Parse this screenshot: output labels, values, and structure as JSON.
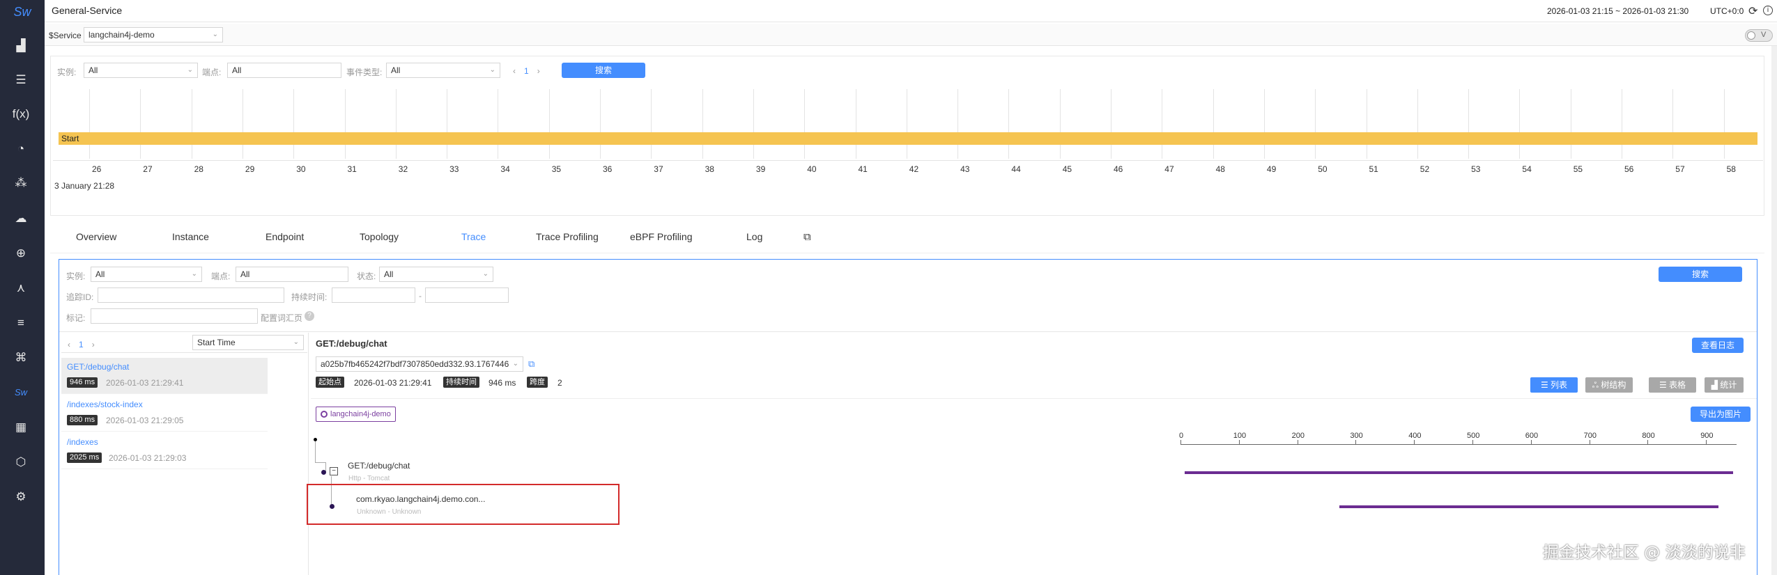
{
  "nav": {
    "logo": "Sw",
    "items": [
      {
        "name": "dashboard-icon",
        "glyph": "▟"
      },
      {
        "name": "database-icon",
        "glyph": "☰"
      },
      {
        "name": "function-icon",
        "glyph": "f(x)"
      },
      {
        "name": "pie-chart-icon",
        "glyph": "◔"
      },
      {
        "name": "dots-icon",
        "glyph": "⁂"
      },
      {
        "name": "cloud-icon",
        "glyph": "☁"
      },
      {
        "name": "globe-icon",
        "glyph": "⊕"
      },
      {
        "name": "network-icon",
        "glyph": "⋏"
      },
      {
        "name": "list-icon",
        "glyph": "≡"
      },
      {
        "name": "topology-icon",
        "glyph": "⌘"
      },
      {
        "name": "sw-icon",
        "glyph": "Sw"
      },
      {
        "name": "widgets-icon",
        "glyph": "▦"
      },
      {
        "name": "shield-icon",
        "glyph": "⬡"
      },
      {
        "name": "settings-icon",
        "glyph": "⚙"
      }
    ]
  },
  "header": {
    "title": "General-Service",
    "time_range": "2026-01-03 21:15 ~ 2026-01-03 21:30",
    "utc": "UTC+0:0"
  },
  "service_bar": {
    "label": "$Service",
    "value": "langchain4j-demo",
    "toggle_label": "V"
  },
  "event_filters": {
    "instance_label": "实例:",
    "instance_value": "All",
    "endpoint_label": "端点:",
    "endpoint_value": "All",
    "event_type_label": "事件类型:",
    "event_type_value": "All",
    "page": "1",
    "search_label": "搜索"
  },
  "timeline": {
    "band_label": "Start",
    "ticks": [
      "26",
      "27",
      "28",
      "29",
      "30",
      "31",
      "32",
      "33",
      "34",
      "35",
      "36",
      "37",
      "38",
      "39",
      "40",
      "41",
      "42",
      "43",
      "44",
      "45",
      "46",
      "47",
      "48",
      "49",
      "50",
      "51",
      "52",
      "53",
      "54",
      "55",
      "56",
      "57",
      "58"
    ],
    "date_label": "3 January 21:28"
  },
  "tabs": {
    "items": [
      "Overview",
      "Instance",
      "Endpoint",
      "Topology",
      "Trace",
      "Trace Profiling",
      "eBPF Profiling",
      "Log"
    ],
    "active": "Trace"
  },
  "trace_filters": {
    "instance_label": "实例:",
    "instance_value": "All",
    "endpoint_label": "端点:",
    "endpoint_value": "All",
    "status_label": "状态:",
    "status_value": "All",
    "trace_id_label": "追踪ID:",
    "duration_label": "持续时间:",
    "duration_sep": "-",
    "tag_label": "标记:",
    "config_label": "配置词汇页",
    "help": "?",
    "search_label": "搜索"
  },
  "trace_list": {
    "page": "1",
    "sort_value": "Start Time",
    "items": [
      {
        "endpoint": "GET:/debug/chat",
        "duration": "946 ms",
        "time": "2026-01-03 21:29:41"
      },
      {
        "endpoint": "/indexes/stock-index",
        "duration": "880 ms",
        "time": "2026-01-03 21:29:05"
      },
      {
        "endpoint": "/indexes",
        "duration": "2025 ms",
        "time": "2026-01-03 21:29:03"
      }
    ]
  },
  "trace_detail": {
    "title": "GET:/debug/chat",
    "view_logs": "查看日志",
    "trace_id": "a025b7fb465242f7bdf7307850edd332.93.1767446",
    "start_label": "起始点",
    "start_value": "2026-01-03 21:29:41",
    "duration_label": "持续时间",
    "duration_value": "946 ms",
    "span_label": "跨度",
    "span_value": "2",
    "view_buttons": [
      {
        "label": "☰ 列表",
        "active": true
      },
      {
        "label": "ஃ 树结构",
        "active": false
      },
      {
        "label": "☰ 表格",
        "active": false
      },
      {
        "label": "▟ 统计",
        "active": false
      }
    ],
    "export_label": "导出为图片",
    "service_badge": "langchain4j-demo",
    "ruler": [
      0,
      100,
      200,
      300,
      400,
      500,
      600,
      700,
      800,
      900
    ],
    "ruler_max": 946,
    "spans": [
      {
        "name": "GET:/debug/chat",
        "sub": "Http - Tomcat",
        "start": 0,
        "end": 946
      },
      {
        "name": "com.rkyao.langchain4j.demo.con...",
        "sub": "Unknown - Unknown",
        "start": 265,
        "end": 921
      }
    ]
  },
  "watermark": "掘金技术社区 @ 淡淡的说非"
}
